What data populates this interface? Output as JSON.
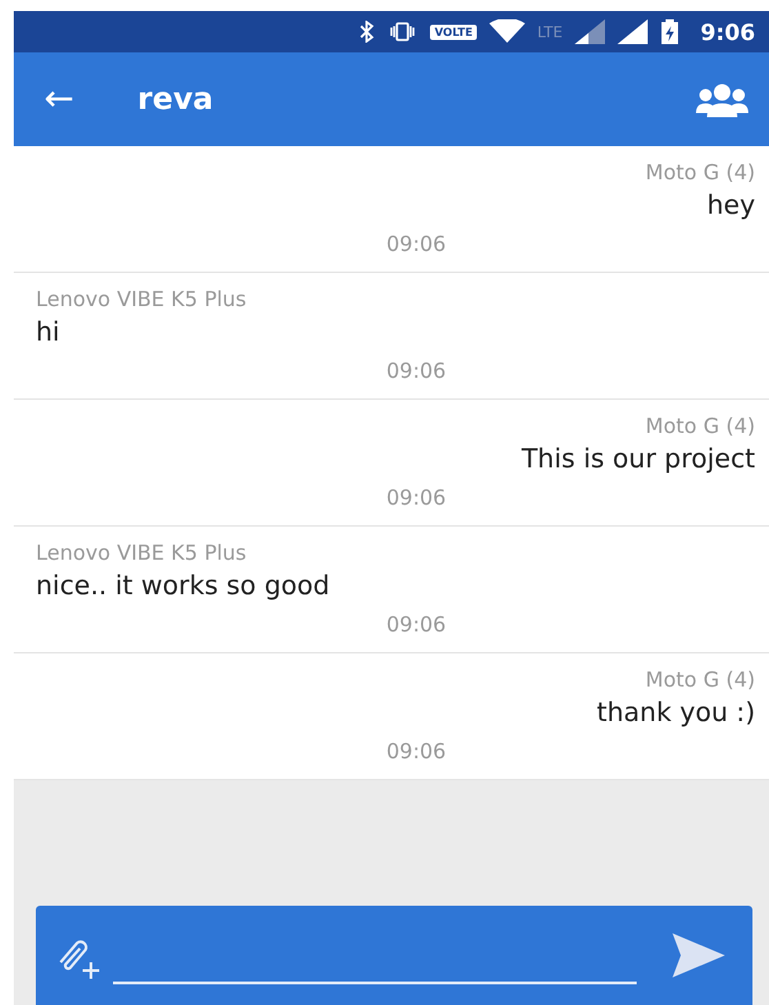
{
  "status_bar": {
    "time": "9:06",
    "volte": "VOLTE",
    "network": "LTE"
  },
  "app_bar": {
    "back": "←",
    "title": "reva"
  },
  "messages": [
    {
      "kind": "sent",
      "sender": "Moto G (4)",
      "text": "hey",
      "time": "09:06"
    },
    {
      "kind": "received",
      "sender": "Lenovo VIBE K5 Plus",
      "text": "hi",
      "time": "09:06"
    },
    {
      "kind": "sent",
      "sender": "Moto G (4)",
      "text": "This is our project",
      "time": "09:06"
    },
    {
      "kind": "received",
      "sender": "Lenovo VIBE K5 Plus",
      "text": "nice.. it works so good",
      "time": "09:06"
    },
    {
      "kind": "sent",
      "sender": "Moto G (4)",
      "text": "thank you :)",
      "time": "09:06"
    }
  ]
}
